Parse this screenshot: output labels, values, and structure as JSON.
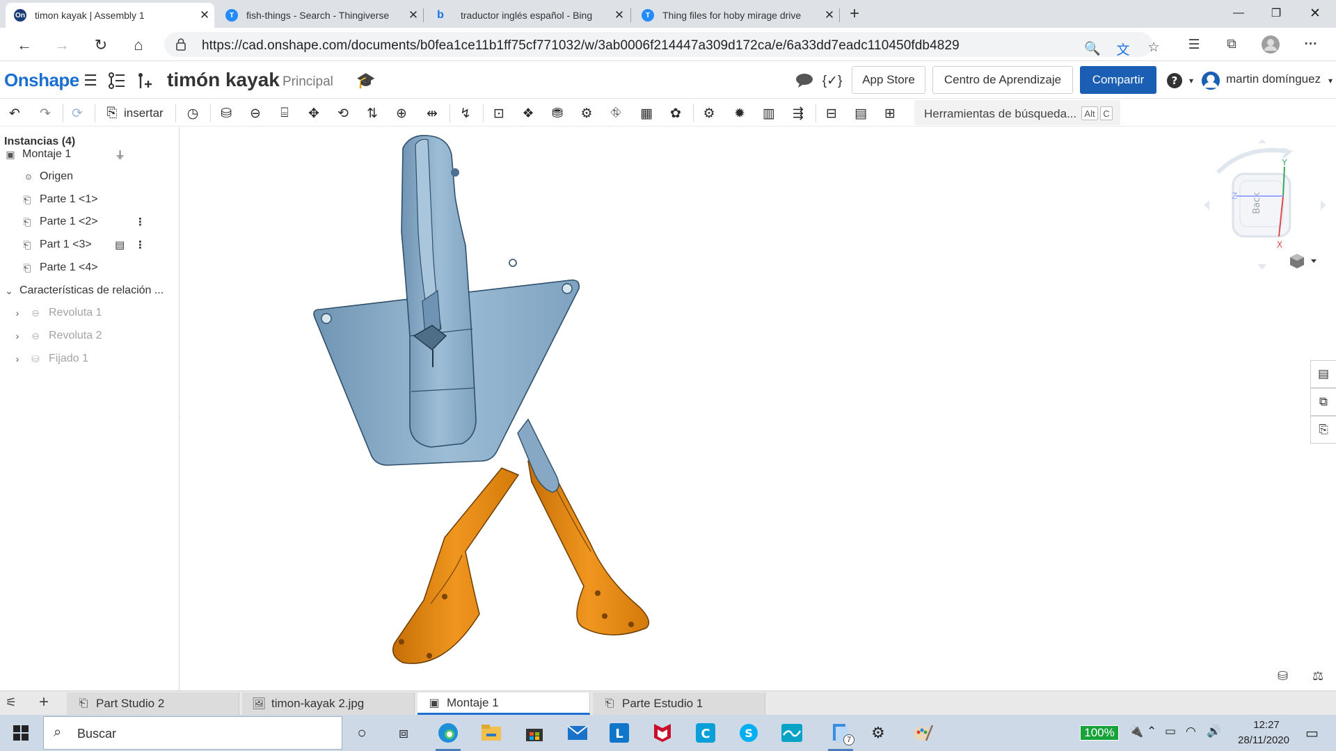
{
  "browser": {
    "tabs": [
      {
        "title": "timon kayak | Assembly 1",
        "favicon": "onshape-favicon",
        "favicon_text": "On",
        "favicon_color": "#1a3c78"
      },
      {
        "title": "fish-things - Search - Thingiverse",
        "favicon": "thingiverse-favicon",
        "favicon_text": "T",
        "favicon_color": "#248bfb"
      },
      {
        "title": "traductor inglés español - Bing",
        "favicon": "bing-favicon",
        "favicon_text": "b",
        "favicon_color": "#1a73e8"
      },
      {
        "title": "Thing files for hoby mirage drive",
        "favicon": "thingiverse-favicon",
        "favicon_text": "T",
        "favicon_color": "#248bfb"
      }
    ],
    "url": "https://cad.onshape.com/documents/b0fea1ce11b1ff75cf771032/w/3ab0006f214447a309d172ca/e/6a33dd7eadc110450fdb4829"
  },
  "header": {
    "logo": "Onshape",
    "doc_title": "timón kayak",
    "branch": "Principal",
    "app_store": "App Store",
    "learning_center": "Centro de Aprendizaje",
    "share": "Compartir",
    "user": "martin domínguez",
    "accent": "#1a5fb4"
  },
  "toolbar": {
    "insert": "insertar",
    "search_tools": "Herramientas de búsqueda...",
    "shortcut_alt": "Alt",
    "shortcut_key": "C"
  },
  "instances": {
    "title": "Instancias (4)",
    "assembly": "Montaje 1",
    "origin": "Origen",
    "parts": [
      "Parte 1 <1>",
      "Parte 1 <2>",
      "Part 1 <3>",
      "Parte 1 <4>"
    ],
    "mates_title": "Características de relación ...",
    "mates": [
      "Revoluta 1",
      "Revoluta 2",
      "Fijado 1"
    ]
  },
  "viewcube": {
    "back": "Back",
    "axis_x": "X",
    "axis_y": "Y",
    "axis_z": "Z"
  },
  "bottom_tabs": [
    "Part Studio 2",
    "timon-kayak 2.jpg",
    "Montaje 1",
    "Parte Estudio 1"
  ],
  "taskbar": {
    "search": "Buscar",
    "battery": "100%",
    "time": "12:27",
    "date": "28/11/2020",
    "badge": "7"
  },
  "colors": {
    "part_blue": "#8fb2cc",
    "part_orange": "#e88c14",
    "taskbar": "#cdd9e6"
  }
}
